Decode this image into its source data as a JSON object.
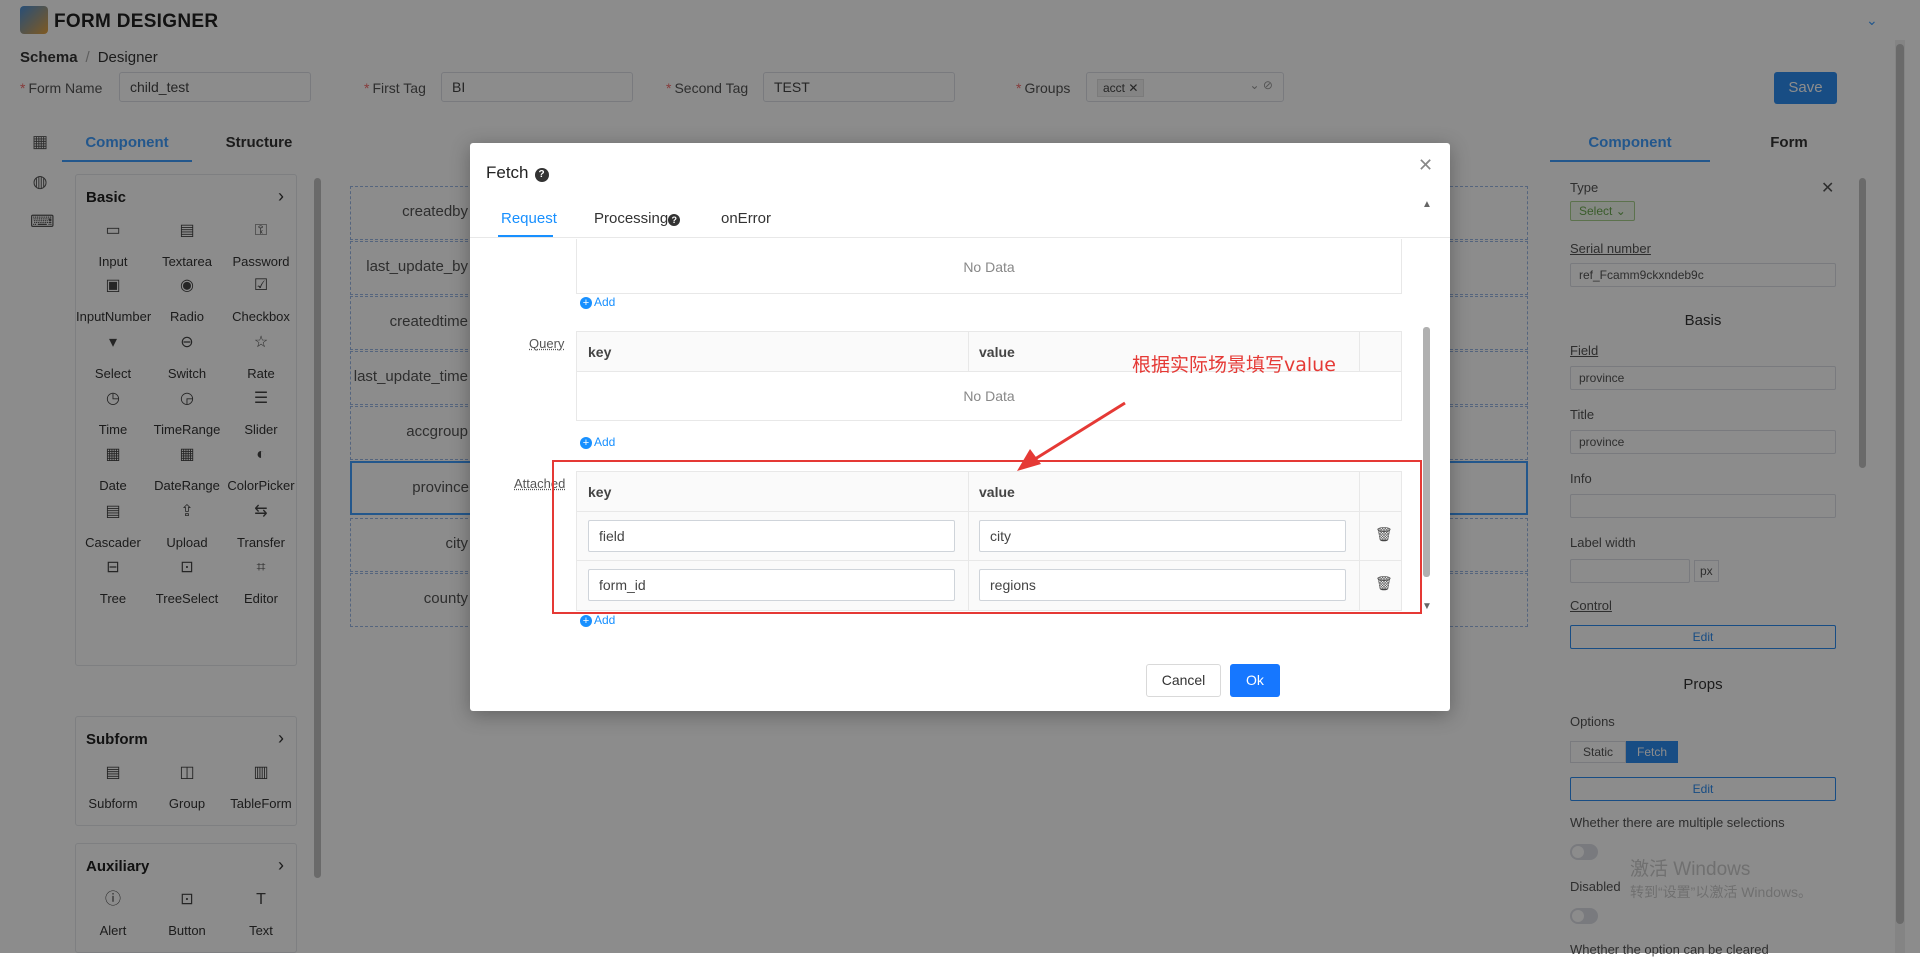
{
  "app": {
    "title": "FORM DESIGNER"
  },
  "breadcrumb": {
    "root": "Schema",
    "current": "Designer"
  },
  "meta_fields": {
    "form_name": {
      "label": "Form Name",
      "value": "child_test"
    },
    "first_tag": {
      "label": "First Tag",
      "value": "BI"
    },
    "second_tag": {
      "label": "Second Tag",
      "value": "TEST"
    },
    "groups": {
      "label": "Groups",
      "tag": "acct"
    }
  },
  "save_label": "Save",
  "left_tabs": [
    "Component",
    "Structure"
  ],
  "groups": [
    {
      "title": "Basic",
      "items": [
        "Input",
        "Textarea",
        "Password",
        "InputNumber",
        "Radio",
        "Checkbox",
        "Select",
        "Switch",
        "Rate",
        "Time",
        "TimeRange",
        "Slider",
        "Date",
        "DateRange",
        "ColorPicker",
        "Cascader",
        "Upload",
        "Transfer",
        "Tree",
        "TreeSelect",
        "Editor"
      ]
    },
    {
      "title": "Subform",
      "items": [
        "Subform",
        "Group",
        "TableForm"
      ]
    },
    {
      "title": "Auxiliary",
      "items": [
        "Alert",
        "Button",
        "Text"
      ]
    }
  ],
  "canvas_rows": [
    "createdby",
    "last_update_by",
    "createdtime",
    "last_update_time",
    "accgroup",
    "province",
    "city",
    "county"
  ],
  "right_tabs": [
    "Component",
    "Form"
  ],
  "right_panel": {
    "type_label": "Type",
    "type_value": "Select",
    "serial_label": "Serial number",
    "serial_value": "ref_Fcamm9ckxndeb9c",
    "basis_heading": "Basis",
    "field_label": "Field",
    "field_value": "province",
    "title_label": "Title",
    "title_value": "province",
    "info_label": "Info",
    "label_width_label": "Label width",
    "label_width_unit": "px",
    "control_label": "Control",
    "edit_label": "Edit",
    "props_heading": "Props",
    "options_label": "Options",
    "options_static": "Static",
    "options_fetch": "Fetch",
    "multiple_label": "Whether there are multiple selections",
    "disabled_label": "Disabled",
    "cleared_label": "Whether the option can be cleared"
  },
  "modal": {
    "title": "Fetch",
    "tabs": [
      "Request",
      "Processing",
      "onError"
    ],
    "no_data": "No Data",
    "add_label": "Add",
    "query_label": "Query",
    "attached_label": "Attached",
    "col_key": "key",
    "col_value": "value",
    "attached_rows": [
      {
        "key": "field",
        "value": "city"
      },
      {
        "key": "form_id",
        "value": "regions"
      }
    ],
    "annotation": "根据实际场景填写value",
    "cancel_label": "Cancel",
    "ok_label": "Ok"
  },
  "watermark": {
    "line1": "激活 Windows",
    "line2": "转到“设置”以激活 Windows。"
  },
  "colors": {
    "accent": "#409eff",
    "annotation_red": "#e53935",
    "ok_button": "#1677ff"
  }
}
